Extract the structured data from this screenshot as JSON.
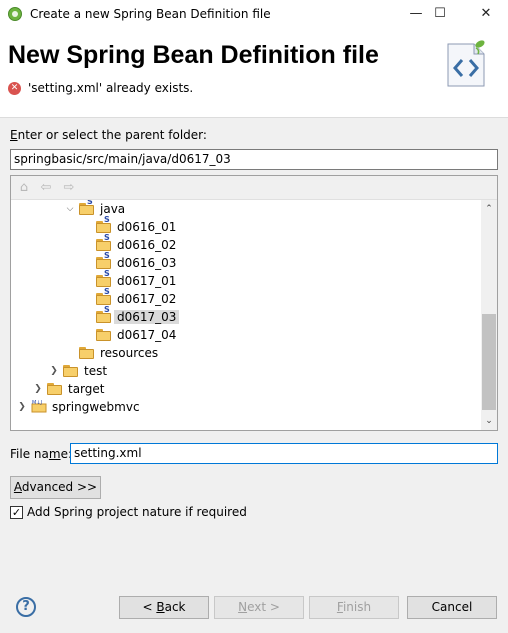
{
  "window": {
    "title": "Create a new Spring Bean Definition file",
    "minimize": "—",
    "maximize": "☐",
    "close": "✕"
  },
  "header": {
    "title": "New Spring Bean Definition file",
    "error_message": "'setting.xml' already exists.",
    "error_icon": "error-icon",
    "banner_icon": "spring-bean-file-icon"
  },
  "parent_folder": {
    "label_mnemonic": "E",
    "label_rest": "nter or select the parent folder:",
    "value": "springbasic/src/main/java/d0617_03"
  },
  "tree": {
    "toolbar": [
      "home-icon",
      "back-icon",
      "forward-icon"
    ],
    "rows": [
      {
        "label": "java",
        "expanded": true
      },
      {
        "label": "d0616_01"
      },
      {
        "label": "d0616_02"
      },
      {
        "label": "d0616_03"
      },
      {
        "label": "d0617_01"
      },
      {
        "label": "d0617_02"
      },
      {
        "label": "d0617_03",
        "selected": true
      },
      {
        "label": "d0617_04"
      },
      {
        "label": "resources"
      },
      {
        "label": "test",
        "expanded": false
      },
      {
        "label": "target",
        "expanded": false
      },
      {
        "label": "springwebmvc",
        "expanded": false
      }
    ]
  },
  "file_name": {
    "label_a": "File na",
    "label_mnemonic": "m",
    "label_b": "e:",
    "value": "setting.xml"
  },
  "advanced_button": {
    "mnemonic": "A",
    "rest": "dvanced >>"
  },
  "spring_nature_checkbox": {
    "label": "Add Spring project nature if required",
    "checked": true
  },
  "footer": {
    "help": "?",
    "back": {
      "prefix": "< ",
      "mnemonic": "B",
      "rest": "ack"
    },
    "next": {
      "mnemonic": "N",
      "rest": "ext >"
    },
    "finish": {
      "mnemonic": "F",
      "rest": "inish"
    },
    "cancel": "Cancel"
  }
}
